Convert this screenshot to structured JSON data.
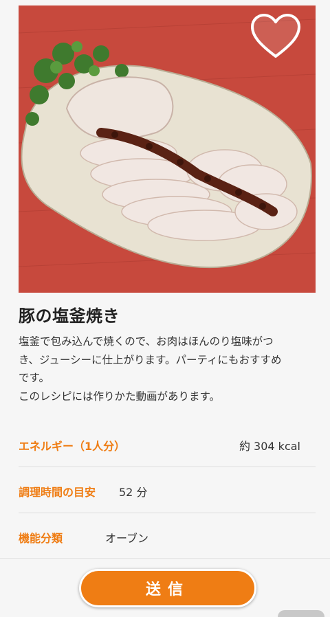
{
  "recipe": {
    "title": "豚の塩釜焼き",
    "description_lines": [
      "塩釜で包み込んで焼くので、お肉はほんのり塩味がつ",
      "き、ジューシーに仕上がります。パーティにもおすすめ",
      "です。",
      "このレシピには作りかた動画があります。"
    ],
    "details": [
      {
        "label": "エネルギー（1人分）",
        "value": "約 304 kcal"
      },
      {
        "label": "調理時間の目安",
        "value": "52 分"
      },
      {
        "label": "機能分類",
        "value": "オーブン"
      }
    ]
  },
  "footer": {
    "send_label": "送信"
  },
  "colors": {
    "accent": "#ef7d14",
    "background": "#f6f6f6"
  },
  "icons": {
    "favorite": "heart-outline-icon"
  }
}
